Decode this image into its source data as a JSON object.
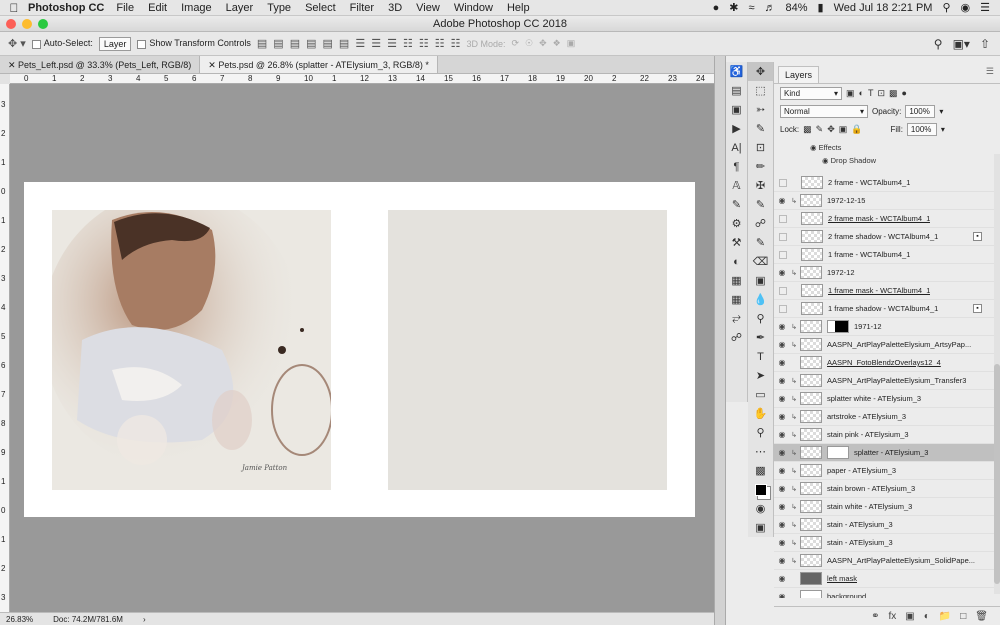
{
  "menubar": {
    "app": "Photoshop CC",
    "items": [
      "File",
      "Edit",
      "Image",
      "Layer",
      "Type",
      "Select",
      "Filter",
      "3D",
      "View",
      "Window",
      "Help"
    ],
    "battery": "84%",
    "datetime": "Wed Jul 18  2:21 PM"
  },
  "window": {
    "title": "Adobe Photoshop CC 2018"
  },
  "options": {
    "auto_select": "Auto-Select:",
    "layer_select": "Layer",
    "show_transform": "Show Transform Controls",
    "mode_3d": "3D Mode:"
  },
  "tabs": [
    {
      "label": "Pets_Left.psd @ 33.3% (Pets_Left, RGB/8)"
    },
    {
      "label": "Pets.psd @ 26.8% (splatter - ATElysium_3, RGB/8) *"
    }
  ],
  "hruler": [
    "0",
    "1",
    "2",
    "3",
    "4",
    "5",
    "6",
    "7",
    "8",
    "9",
    "10",
    "1",
    "12",
    "13",
    "14",
    "15",
    "16",
    "17",
    "18",
    "19",
    "20",
    "2",
    "22",
    "23",
    "24"
  ],
  "vruler": [
    "3",
    "2",
    "1",
    "0",
    "1",
    "2",
    "3",
    "4",
    "5",
    "6",
    "7",
    "8",
    "9",
    "1",
    "0",
    "1",
    "2",
    "3"
  ],
  "photo": {
    "signature": "Jamie Patton"
  },
  "status": {
    "zoom": "26.83%",
    "doc": "Doc: 74.2M/781.6M"
  },
  "layers_panel": {
    "title": "Layers",
    "filter_kind": "Kind",
    "blend_mode": "Normal",
    "opacity_label": "Opacity:",
    "opacity": "100%",
    "lock_label": "Lock:",
    "fill_label": "Fill:",
    "fill": "100%",
    "effects_label": "Effects",
    "drop_shadow_label": "Drop Shadow",
    "layers": [
      {
        "name": "2 frame - WCTAlbum4_1",
        "visible": false,
        "clip": false,
        "thumb": "checker",
        "ul": false
      },
      {
        "name": "1972-12-15",
        "visible": true,
        "clip": true,
        "thumb": "checker",
        "ul": false
      },
      {
        "name": "2 frame mask - WCTAlbum4_1",
        "visible": false,
        "clip": false,
        "thumb": "checker",
        "ul": true
      },
      {
        "name": "2 frame shadow - WCTAlbum4_1",
        "visible": false,
        "clip": false,
        "thumb": "checker",
        "ul": false,
        "fx": true
      },
      {
        "name": "1 frame - WCTAlbum4_1",
        "visible": false,
        "clip": false,
        "thumb": "checker",
        "ul": false
      },
      {
        "name": "1972-12",
        "visible": true,
        "clip": true,
        "thumb": "checker",
        "ul": false
      },
      {
        "name": "1 frame mask - WCTAlbum4_1",
        "visible": false,
        "clip": false,
        "thumb": "checker",
        "ul": true
      },
      {
        "name": "1 frame shadow - WCTAlbum4_1",
        "visible": false,
        "clip": false,
        "thumb": "checker",
        "ul": false,
        "fx": true
      },
      {
        "name": "1971-12",
        "visible": true,
        "clip": true,
        "thumb": "checker",
        "ul": false,
        "mask": "black"
      },
      {
        "name": "AASPN_ArtPlayPaletteElysium_ArtsyPap...",
        "visible": true,
        "clip": true,
        "thumb": "checker",
        "ul": false
      },
      {
        "name": "AASPN_FotoBlendzOverlays12_4",
        "visible": true,
        "clip": false,
        "thumb": "checker",
        "ul": true
      },
      {
        "name": "AASPN_ArtPlayPaletteElysium_Transfer3",
        "visible": true,
        "clip": true,
        "thumb": "checker",
        "ul": false
      },
      {
        "name": "splatter white - ATElysium_3",
        "visible": true,
        "clip": true,
        "thumb": "checker",
        "ul": false
      },
      {
        "name": "artstroke - ATElysium_3",
        "visible": true,
        "clip": true,
        "thumb": "checker",
        "ul": false
      },
      {
        "name": "stain pink - ATElysium_3",
        "visible": true,
        "clip": true,
        "thumb": "checker",
        "ul": false
      },
      {
        "name": "splatter - ATElysium_3",
        "visible": true,
        "clip": true,
        "thumb": "checker",
        "ul": false,
        "mask": "white",
        "active": true
      },
      {
        "name": "paper - ATElysium_3",
        "visible": true,
        "clip": true,
        "thumb": "checker",
        "ul": false
      },
      {
        "name": "stain brown - ATElysium_3",
        "visible": true,
        "clip": true,
        "thumb": "checker",
        "ul": false
      },
      {
        "name": "stain white - ATElysium_3",
        "visible": true,
        "clip": true,
        "thumb": "checker",
        "ul": false
      },
      {
        "name": "stain - ATElysium_3",
        "visible": true,
        "clip": true,
        "thumb": "checker",
        "ul": false
      },
      {
        "name": "stain - ATElysium_3",
        "visible": true,
        "clip": true,
        "thumb": "checker",
        "ul": false
      },
      {
        "name": "AASPN_ArtPlayPaletteElysium_SolidPape...",
        "visible": true,
        "clip": true,
        "thumb": "checker",
        "ul": false
      },
      {
        "name": "left mask",
        "visible": true,
        "clip": false,
        "thumb": "dark",
        "ul": true
      },
      {
        "name": "background",
        "visible": true,
        "clip": false,
        "thumb": "white",
        "ul": false
      }
    ]
  },
  "colors": {
    "canvas_bg": "#999999",
    "page_bg": "#ffffff",
    "panel_bg": "#ececec",
    "active_layer": "#c0c0c0"
  }
}
